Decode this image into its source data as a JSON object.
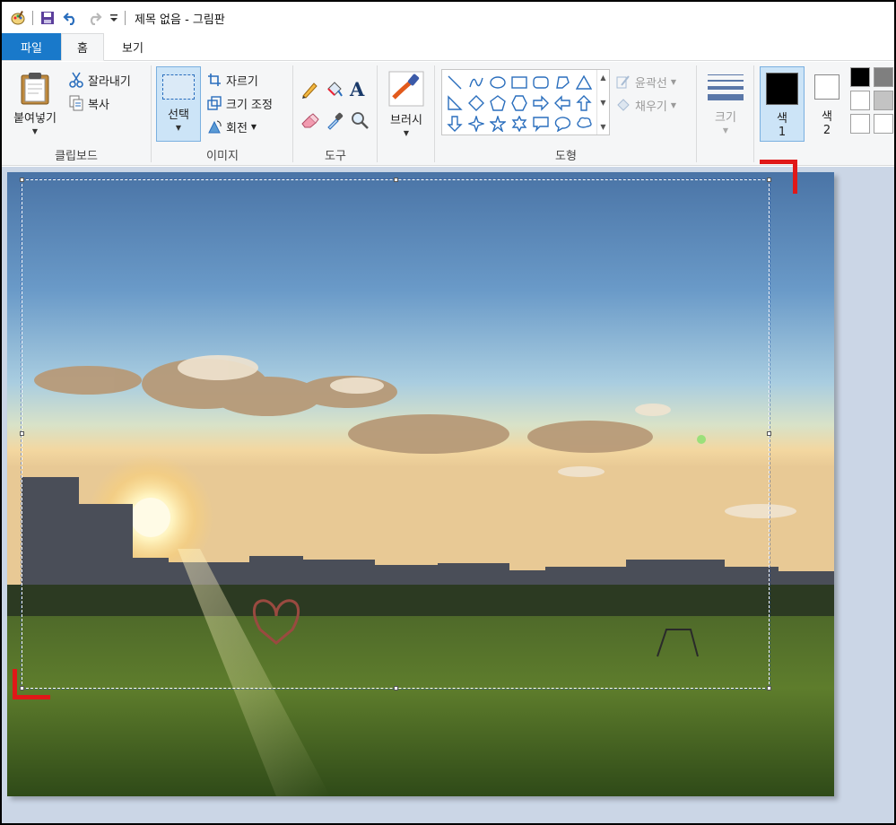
{
  "window": {
    "title": "제목 없음 - 그림판"
  },
  "quick_access": {
    "icons": [
      "paint-app-icon",
      "save-icon",
      "undo-icon",
      "redo-icon",
      "customize-qat-icon"
    ]
  },
  "tabs": [
    {
      "label": "파일"
    },
    {
      "label": "홈"
    },
    {
      "label": "보기"
    }
  ],
  "ribbon": {
    "clipboard": {
      "paste_label": "붙여넣기",
      "cut_label": "잘라내기",
      "copy_label": "복사",
      "group_label": "클립보드"
    },
    "image": {
      "select_label": "선택",
      "crop_label": "자르기",
      "resize_label": "크기 조정",
      "rotate_label": "회전",
      "group_label": "이미지"
    },
    "tools": {
      "group_label": "도구"
    },
    "brushes": {
      "label": "브러시"
    },
    "shapes": {
      "outline_label": "윤곽선",
      "fill_label": "채우기",
      "group_label": "도형"
    },
    "size": {
      "label": "크기"
    },
    "colors": {
      "color1_label": "색",
      "color1_num": "1",
      "color2_label": "색",
      "color2_num": "2",
      "color1_value": "#000000",
      "color2_value": "#ffffff",
      "palette": [
        "#000000",
        "#7f7f7f",
        "#ffffff",
        "#c3c3c3",
        "#ffffff",
        "#ffffff"
      ]
    }
  },
  "colors": {
    "accent": "#1979ca",
    "ribbon_bg": "#f5f6f7",
    "workspace_bg": "#cbd6e6",
    "annotation_red": "#e01818"
  }
}
